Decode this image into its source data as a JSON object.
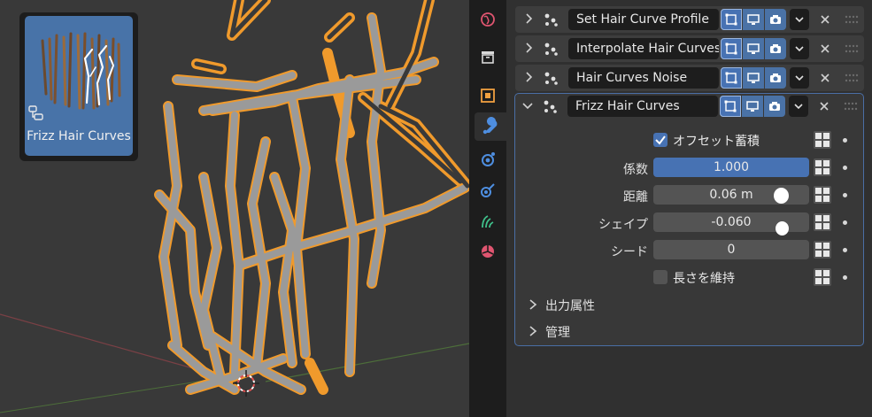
{
  "asset": {
    "name": "Frizz Hair Curves",
    "icon": "node-tree-icon"
  },
  "tabs": [
    {
      "name": "world-icon"
    },
    {
      "name": "collection-icon"
    },
    {
      "name": "object-icon"
    },
    {
      "name": "modifier-wrench-icon",
      "active": true
    },
    {
      "name": "particles-icon"
    },
    {
      "name": "physics-icon"
    },
    {
      "name": "constraints-icon"
    },
    {
      "name": "data-icon"
    }
  ],
  "modifiers": [
    {
      "name": "Set Hair Curve Profile",
      "expanded": false
    },
    {
      "name": "Interpolate Hair Curves",
      "expanded": false
    },
    {
      "name": "Hair Curves Noise",
      "expanded": false
    },
    {
      "name": "Frizz Hair Curves",
      "expanded": true
    }
  ],
  "frizz": {
    "offset_accum_label": "オフセット蓄積",
    "offset_accum_checked": true,
    "factor_label": "係数",
    "factor_value": "1.000",
    "distance_label": "距離",
    "distance_value": "0.06 m",
    "shape_label": "シェイプ",
    "shape_value": "-0.060",
    "seed_label": "シード",
    "seed_value": "0",
    "keep_length_label": "長さを維持",
    "keep_length_checked": false,
    "output_attr_label": "出力属性",
    "manage_label": "管理"
  },
  "colors": {
    "accent": "#4772b3",
    "selection_orange": "#f5a033",
    "hair_gray": "#8f8f8f"
  }
}
